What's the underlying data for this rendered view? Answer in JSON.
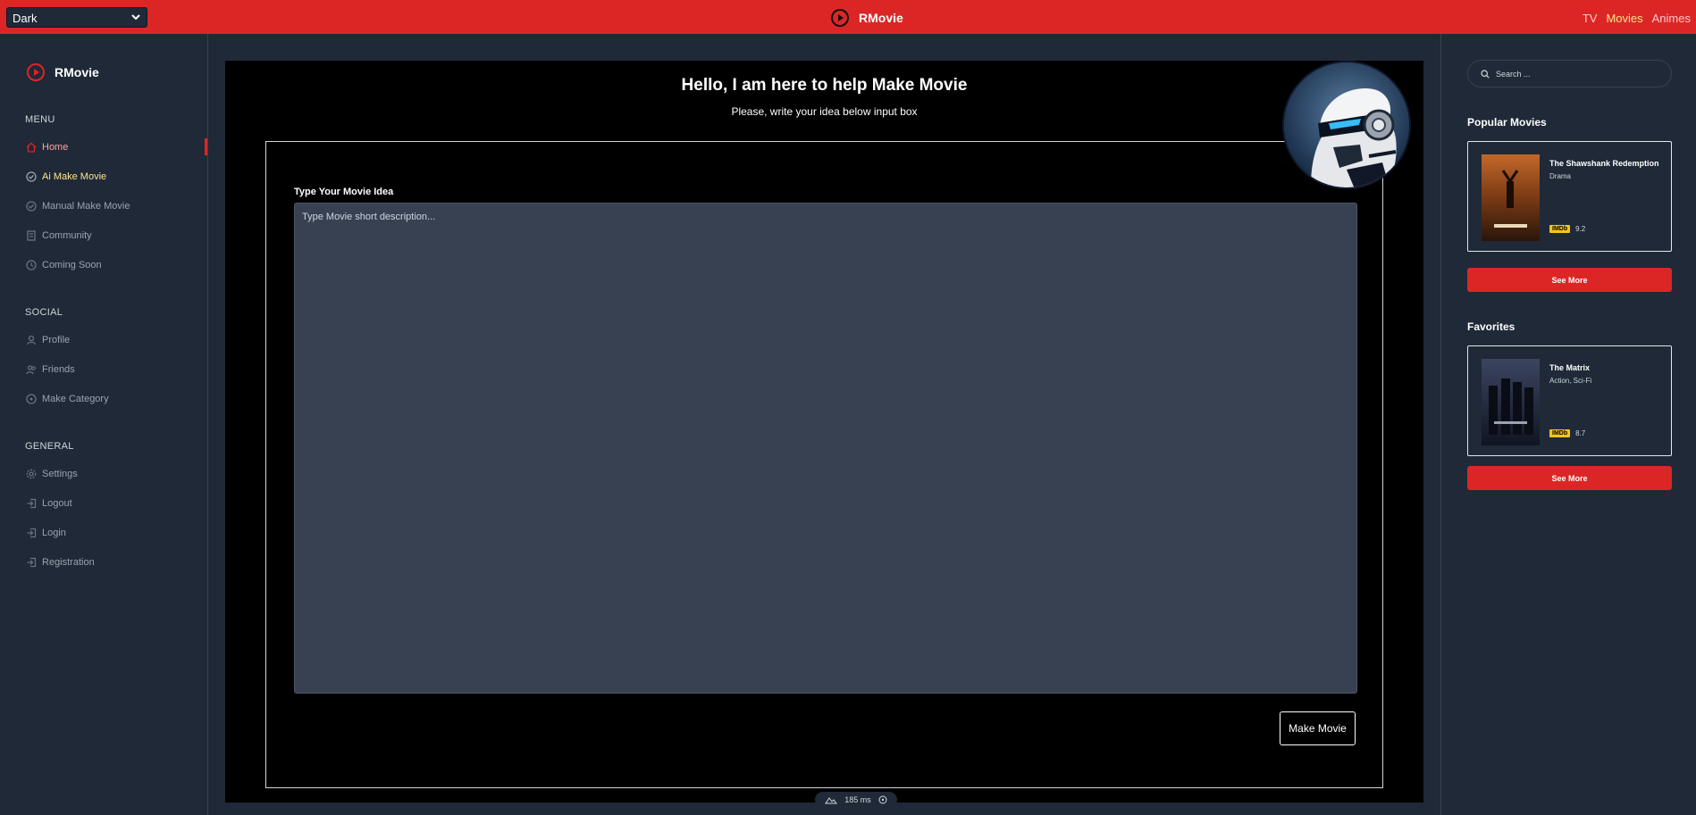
{
  "topbar": {
    "theme_select": "Dark",
    "brand": "RMovie",
    "nav": [
      "TV",
      "Movies",
      "Animes"
    ]
  },
  "sidebar": {
    "brand": "RMovie",
    "menu_heading": "MENU",
    "menu_items": [
      {
        "label": "Home",
        "icon": "home-icon"
      },
      {
        "label": "Ai Make Movie",
        "icon": "check-circle-icon"
      },
      {
        "label": "Manual Make Movie",
        "icon": "check-circle-icon"
      },
      {
        "label": "Community",
        "icon": "community-icon"
      },
      {
        "label": "Coming Soon",
        "icon": "clock-icon"
      }
    ],
    "social_heading": "SOCIAL",
    "social_items": [
      {
        "label": "Profile",
        "icon": "user-icon"
      },
      {
        "label": "Friends",
        "icon": "users-icon"
      },
      {
        "label": "Make Category",
        "icon": "category-icon"
      }
    ],
    "general_heading": "GENERAL",
    "general_items": [
      {
        "label": "Settings",
        "icon": "gear-icon"
      },
      {
        "label": "Logout",
        "icon": "logout-icon"
      },
      {
        "label": "Login",
        "icon": "login-icon"
      },
      {
        "label": "Registration",
        "icon": "registration-icon"
      }
    ]
  },
  "main": {
    "title": "Hello, I am here to help Make Movie",
    "subtitle": "Please, write your idea below input box",
    "idea_label": "Type Your Movie Idea",
    "idea_placeholder": "Type Movie short description...",
    "idea_value": "",
    "submit_label": "Make Movie"
  },
  "bottom_pill": {
    "value": "185 ms"
  },
  "rightbar": {
    "search_placeholder": "Search ...",
    "popular_heading": "Popular Movies",
    "popular": {
      "title": "The Shawshank Redemption",
      "genre": "Drama",
      "imdb_badge": "IMDb",
      "rating": "9.2"
    },
    "popular_see_more": "See More",
    "favorites_heading": "Favorites",
    "favorite": {
      "title": "The Matrix",
      "genre": "Action, Sci-Fi",
      "imdb_badge": "IMDb",
      "rating": "8.7"
    },
    "favorites_see_more": "See More"
  },
  "colors": {
    "accent": "#dc2626",
    "active_link": "#fde68a",
    "panel": "#1f2937",
    "imdb": "#f5c518"
  }
}
